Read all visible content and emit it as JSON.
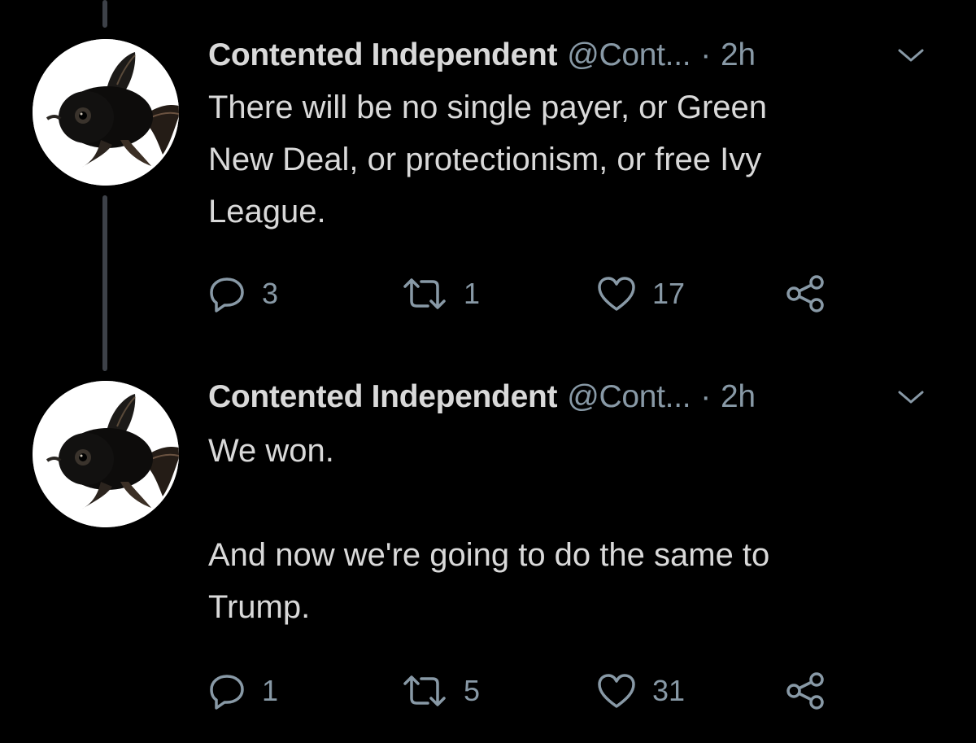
{
  "colors": {
    "background": "#000000",
    "primary_text": "#d9d9d9",
    "secondary_text": "#8899a6",
    "thread_line": "#3d4148"
  },
  "tweets": [
    {
      "display_name": "Contented Independent",
      "handle": "@Cont...",
      "separator": "·",
      "time": "2h",
      "text": "There will be no single payer, or Green\nNew Deal, or protectionism, or free Ivy\nLeague.",
      "actions": {
        "reply_icon": "reply-icon",
        "reply_count": "3",
        "retweet_icon": "retweet-icon",
        "retweet_count": "1",
        "like_icon": "heart-icon",
        "like_count": "17",
        "share_icon": "share-icon"
      },
      "avatar": "goldfish-avatar"
    },
    {
      "display_name": "Contented Independent",
      "handle": "@Cont...",
      "separator": "·",
      "time": "2h",
      "text": "We won.\n\nAnd now we're going to do the same to\nTrump.",
      "actions": {
        "reply_icon": "reply-icon",
        "reply_count": "1",
        "retweet_icon": "retweet-icon",
        "retweet_count": "5",
        "like_icon": "heart-icon",
        "like_count": "31",
        "share_icon": "share-icon"
      },
      "avatar": "goldfish-avatar"
    }
  ]
}
